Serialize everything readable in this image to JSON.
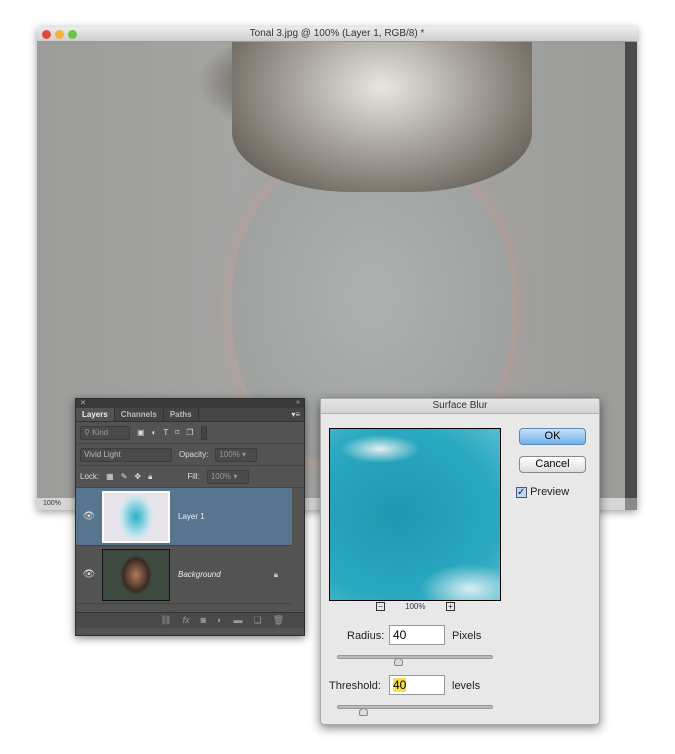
{
  "window": {
    "title": "Tonal 3.jpg @ 100% (Layer 1, RGB/8) *",
    "zoom": "100%",
    "traffic_colors": [
      "#e0493f",
      "#f0b33a",
      "#6cc24a"
    ]
  },
  "layers_panel": {
    "tabs": [
      "Layers",
      "Channels",
      "Paths"
    ],
    "filter_kind": "Kind",
    "blend_mode": "Vivid Light",
    "opacity_label": "Opacity:",
    "opacity_value": "100%",
    "lock_label": "Lock:",
    "fill_label": "Fill:",
    "fill_value": "100%",
    "layers": [
      {
        "name": "Layer 1",
        "selected": true
      },
      {
        "name": "Background",
        "locked": true
      }
    ],
    "highlight_color": "#587590"
  },
  "dialog": {
    "title": "Surface Blur",
    "ok": "OK",
    "cancel": "Cancel",
    "preview_label": "Preview",
    "preview_checked": true,
    "zoom": "100%",
    "zoom_out": "−",
    "zoom_in": "+",
    "radius_label": "Radius:",
    "radius_value": "40",
    "radius_unit": "Pixels",
    "radius_fraction": 0.39,
    "threshold_label": "Threshold:",
    "threshold_value": "40",
    "threshold_unit": "levels",
    "threshold_fraction": 0.16
  }
}
